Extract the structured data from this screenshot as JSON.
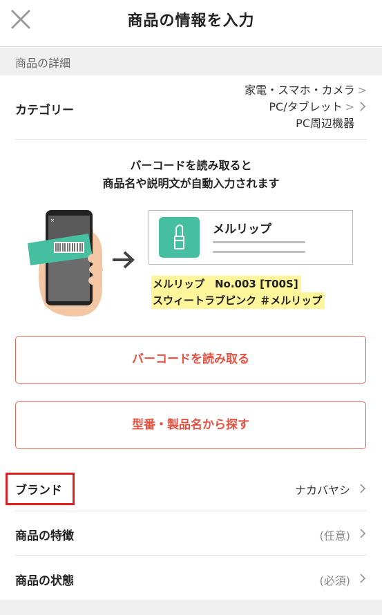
{
  "header": {
    "title": "商品の情報を入力",
    "close_icon": "close-icon"
  },
  "section": {
    "title": "商品の詳細"
  },
  "category": {
    "label": "カテゴリー",
    "path": [
      "家電・スマホ・カメラ",
      "PC/タブレット",
      "PC周辺機器"
    ],
    "separator": ">"
  },
  "barcode_info": {
    "line1": "バーコードを読み取ると",
    "line2": "商品名や説明文が自動入力されます",
    "sample_product_name": "メルリップ",
    "sample_line1": "メルリップ　No.003 [T00S]",
    "sample_line2": "スウィートラブピンク ＃メルリップ"
  },
  "buttons": {
    "scan_barcode": "バーコードを読み取る",
    "search_model": "型番・製品名から探す"
  },
  "brand": {
    "label": "ブランド",
    "value": "ナカバヤシ"
  },
  "features": {
    "label": "商品の特徴",
    "value": "(任意)"
  },
  "condition": {
    "label": "商品の状態",
    "value": "(必須)"
  },
  "colors": {
    "accent": "#e25343",
    "highlight_box": "#e02020",
    "thumb_green": "#46bfa0",
    "highlight_yellow": "#fff59a"
  }
}
